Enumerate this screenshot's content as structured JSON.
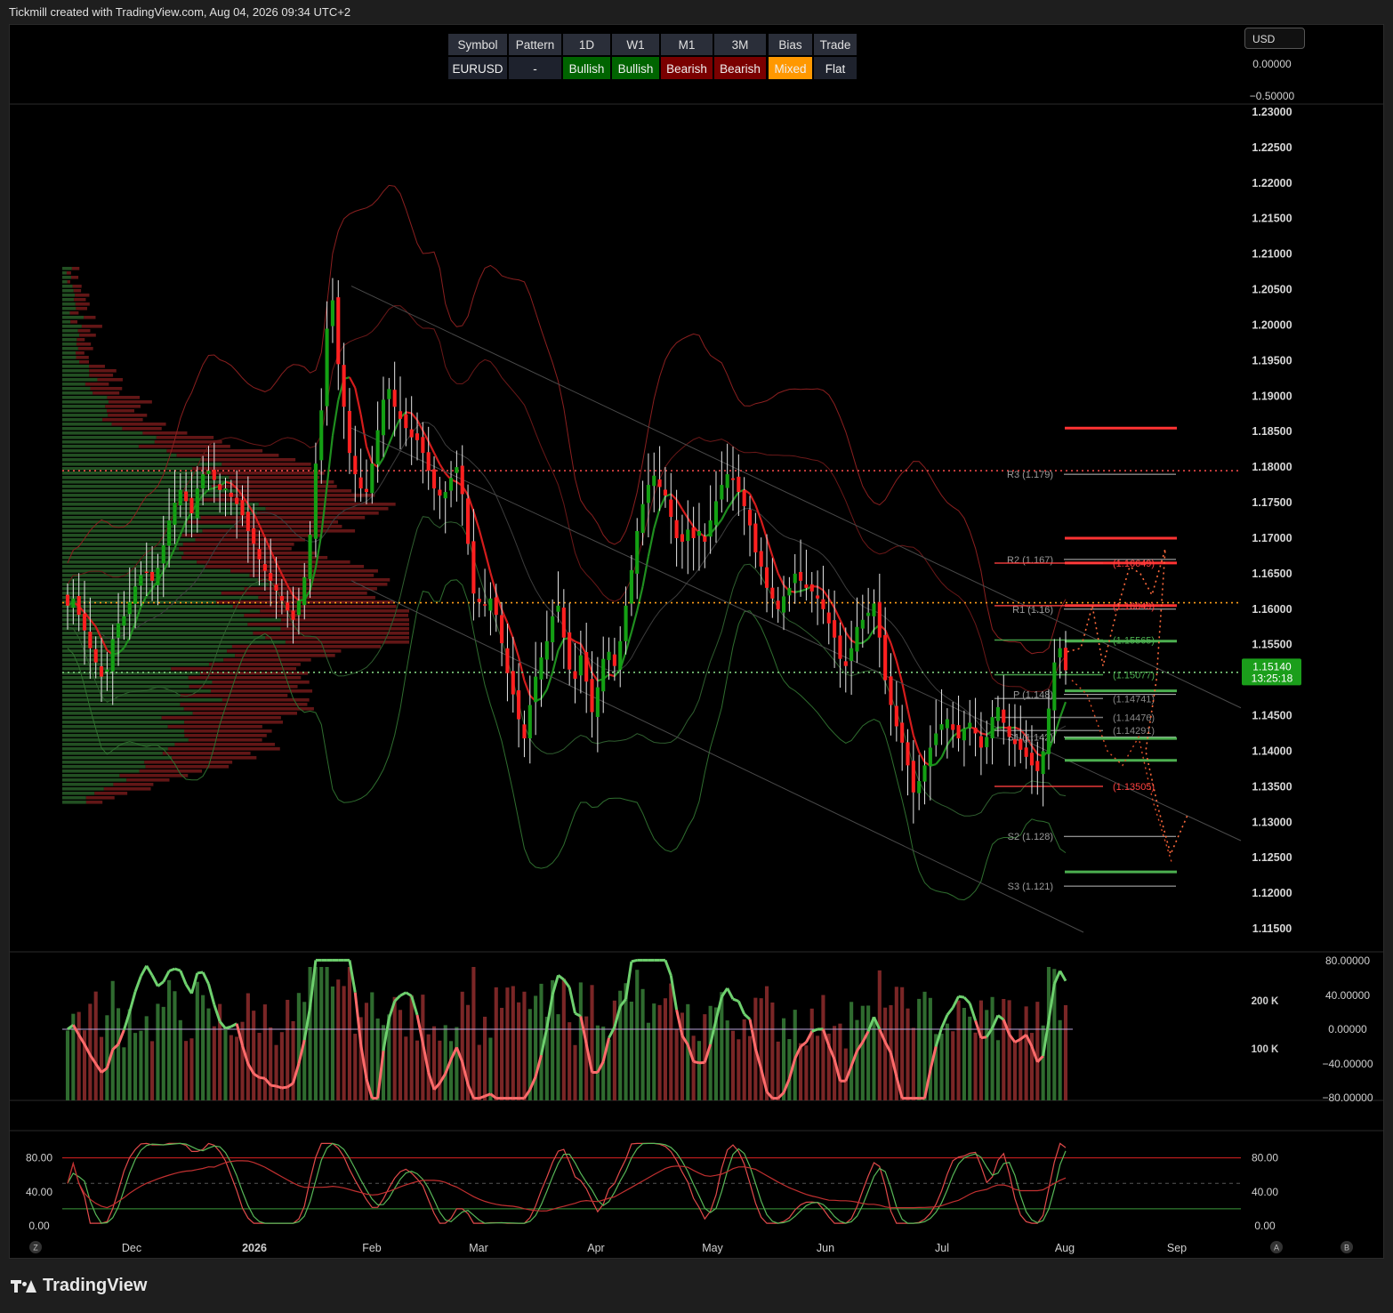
{
  "header": {
    "title": "Tickmill created with TradingView.com, Aug 04, 2026 09:34 UTC+2"
  },
  "currency_selector": "USD",
  "footer": {
    "brand": "TradingView"
  },
  "table": {
    "headers": [
      "Symbol",
      "Pattern",
      "1D",
      "W1",
      "M1",
      "3M",
      "Bias",
      "Trade"
    ],
    "row": [
      "EURUSD",
      "-",
      "Bullish",
      "Bullish",
      "Bearish",
      "Bearish",
      "Mixed",
      "Flat"
    ],
    "colors": [
      "#1e222d",
      "#1e222d",
      "#006400",
      "#006400",
      "#7a0000",
      "#7a0000",
      "#ff9800",
      "#1e222d"
    ]
  },
  "nav_buttons": {
    "z": "Z",
    "a": "A",
    "b": "B"
  },
  "colors": {
    "bull": "#14a014",
    "bear": "#ff2020",
    "price_tag": "#1b9e1b",
    "pivot_orange": "#ff8c00",
    "pivot_red": "#ff3333",
    "pivot_green": "#4caf50"
  },
  "chart_data": [
    {
      "type": "candlestick",
      "symbol": "EURUSD",
      "y_ticks": [
        "1.23000",
        "1.22500",
        "1.22000",
        "1.21500",
        "1.21000",
        "1.20500",
        "1.20000",
        "1.19500",
        "1.19000",
        "1.18500",
        "1.18000",
        "1.17500",
        "1.17000",
        "1.16500",
        "1.16000",
        "1.15500",
        "1.15000",
        "1.14500",
        "1.14000",
        "1.13500",
        "1.13000",
        "1.12500",
        "1.12000",
        "1.11500"
      ],
      "ylim": [
        1.1125,
        1.2313
      ],
      "x_ticks": [
        "Dec",
        "2026",
        "Feb",
        "Mar",
        "Apr",
        "May",
        "Jun",
        "Jul",
        "Aug",
        "Sep"
      ],
      "current_price": {
        "value": "1.15140",
        "countdown": "13:25:18"
      },
      "pivot_levels": [
        {
          "label": "R3 (1.179)",
          "value": 1.179
        },
        {
          "label": "R2 (1.167)",
          "value": 1.167
        },
        {
          "label": "R1 (1.16)",
          "value": 1.16
        },
        {
          "label": "P (1.148)",
          "value": 1.148
        },
        {
          "label": "S1 (1.142)",
          "value": 1.142
        },
        {
          "label": "S2 (1.128)",
          "value": 1.128
        },
        {
          "label": "S3 (1.121)",
          "value": 1.121
        }
      ],
      "price_labels": [
        {
          "label": "(1.16649)",
          "value": 1.16649,
          "color": "#ff4040"
        },
        {
          "label": "(1.16049)",
          "value": 1.16049,
          "color": "#ff4040"
        },
        {
          "label": "(1.15565)",
          "value": 1.15565,
          "color": "#4caf50"
        },
        {
          "label": "(1.15077)",
          "value": 1.15077,
          "color": "#4caf50"
        },
        {
          "label": "(1.14741)",
          "value": 1.14741,
          "color": "#888888"
        },
        {
          "label": "(1.14476)",
          "value": 1.14476,
          "color": "#888888"
        },
        {
          "label": "(1.14291)",
          "value": 1.14291,
          "color": "#888888"
        },
        {
          "label": "(1.13505)",
          "value": 1.13505,
          "color": "#ff4040"
        }
      ],
      "zone_lines": [
        {
          "value": 1.1855,
          "color": "#ff3333"
        },
        {
          "value": 1.17,
          "color": "#ff3333"
        },
        {
          "value": 1.1665,
          "color": "#ff3333"
        },
        {
          "value": 1.1605,
          "color": "#ff3333"
        },
        {
          "value": 1.1555,
          "color": "#4caf50"
        },
        {
          "value": 1.1485,
          "color": "#4caf50"
        },
        {
          "value": 1.1418,
          "color": "#4caf50"
        },
        {
          "value": 1.1387,
          "color": "#4caf50"
        },
        {
          "value": 1.123,
          "color": "#4caf50"
        }
      ],
      "dotted_levels": [
        {
          "value": 1.1795,
          "color": "#ff4d4d"
        },
        {
          "value": 1.1609,
          "color": "#ff9f1a"
        },
        {
          "value": 1.1511,
          "color": "#7fd07f"
        }
      ],
      "closes": [
        1.1605,
        1.1615,
        1.1592,
        1.157,
        1.1545,
        1.1525,
        1.1505,
        1.1515,
        1.1558,
        1.158,
        1.159,
        1.161,
        1.1632,
        1.1648,
        1.1652,
        1.164,
        1.1658,
        1.169,
        1.1725,
        1.175,
        1.1768,
        1.1752,
        1.1735,
        1.177,
        1.179,
        1.1795,
        1.1782,
        1.1768,
        1.177,
        1.1758,
        1.1748,
        1.1732,
        1.171,
        1.1692,
        1.167,
        1.1654,
        1.164,
        1.1626,
        1.1612,
        1.1598,
        1.1585,
        1.1612,
        1.1645,
        1.1705,
        1.1805,
        1.188,
        1.1995,
        1.2035,
        1.1945,
        1.1885,
        1.182,
        1.179,
        1.177,
        1.1765,
        1.1805,
        1.1852,
        1.1895,
        1.191,
        1.1885,
        1.1868,
        1.1855,
        1.1842,
        1.1838,
        1.182,
        1.1795,
        1.177,
        1.176,
        1.1765,
        1.1785,
        1.18,
        1.1762,
        1.1692,
        1.1622,
        1.161,
        1.1605,
        1.1615,
        1.1592,
        1.1552,
        1.151,
        1.148,
        1.1445,
        1.1418,
        1.1465,
        1.1505,
        1.1532,
        1.1555,
        1.159,
        1.1605,
        1.156,
        1.1515,
        1.1502,
        1.1535,
        1.1498,
        1.1455,
        1.149,
        1.153,
        1.154,
        1.152,
        1.1555,
        1.1605,
        1.1655,
        1.171,
        1.1748,
        1.1775,
        1.1788,
        1.1772,
        1.176,
        1.173,
        1.17,
        1.1695,
        1.1712,
        1.17,
        1.171,
        1.1695,
        1.1725,
        1.1752,
        1.1775,
        1.179,
        1.1782,
        1.1765,
        1.1745,
        1.1718,
        1.168,
        1.166,
        1.163,
        1.1615,
        1.16,
        1.1618,
        1.163,
        1.165,
        1.164,
        1.163,
        1.1625,
        1.1615,
        1.16,
        1.158,
        1.156,
        1.153,
        1.152,
        1.1545,
        1.1575,
        1.1585,
        1.1595,
        1.1608,
        1.156,
        1.15,
        1.1465,
        1.1435,
        1.1412,
        1.138,
        1.1342,
        1.1358,
        1.138,
        1.1405,
        1.1425,
        1.1438,
        1.1445,
        1.143,
        1.1418,
        1.1432,
        1.144,
        1.1425,
        1.1405,
        1.142,
        1.1448,
        1.1462,
        1.144,
        1.142,
        1.141,
        1.1402,
        1.1392,
        1.138,
        1.1372,
        1.14,
        1.146,
        1.1525,
        1.1545,
        1.1514
      ],
      "indicator_ticks": {
        "osc": [
          "80.00000",
          "40.00000",
          "0.00000",
          "−40.00000",
          "−80.00000"
        ],
        "volume": [
          "200 K",
          "100 K"
        ],
        "top": [
          "0.00000",
          "−0.50000"
        ]
      },
      "stoch_ticks_left": [
        "80.00",
        "40.00",
        "0.00"
      ],
      "stoch_ticks_right": [
        "80.00",
        "40.00",
        "0.00"
      ]
    }
  ]
}
